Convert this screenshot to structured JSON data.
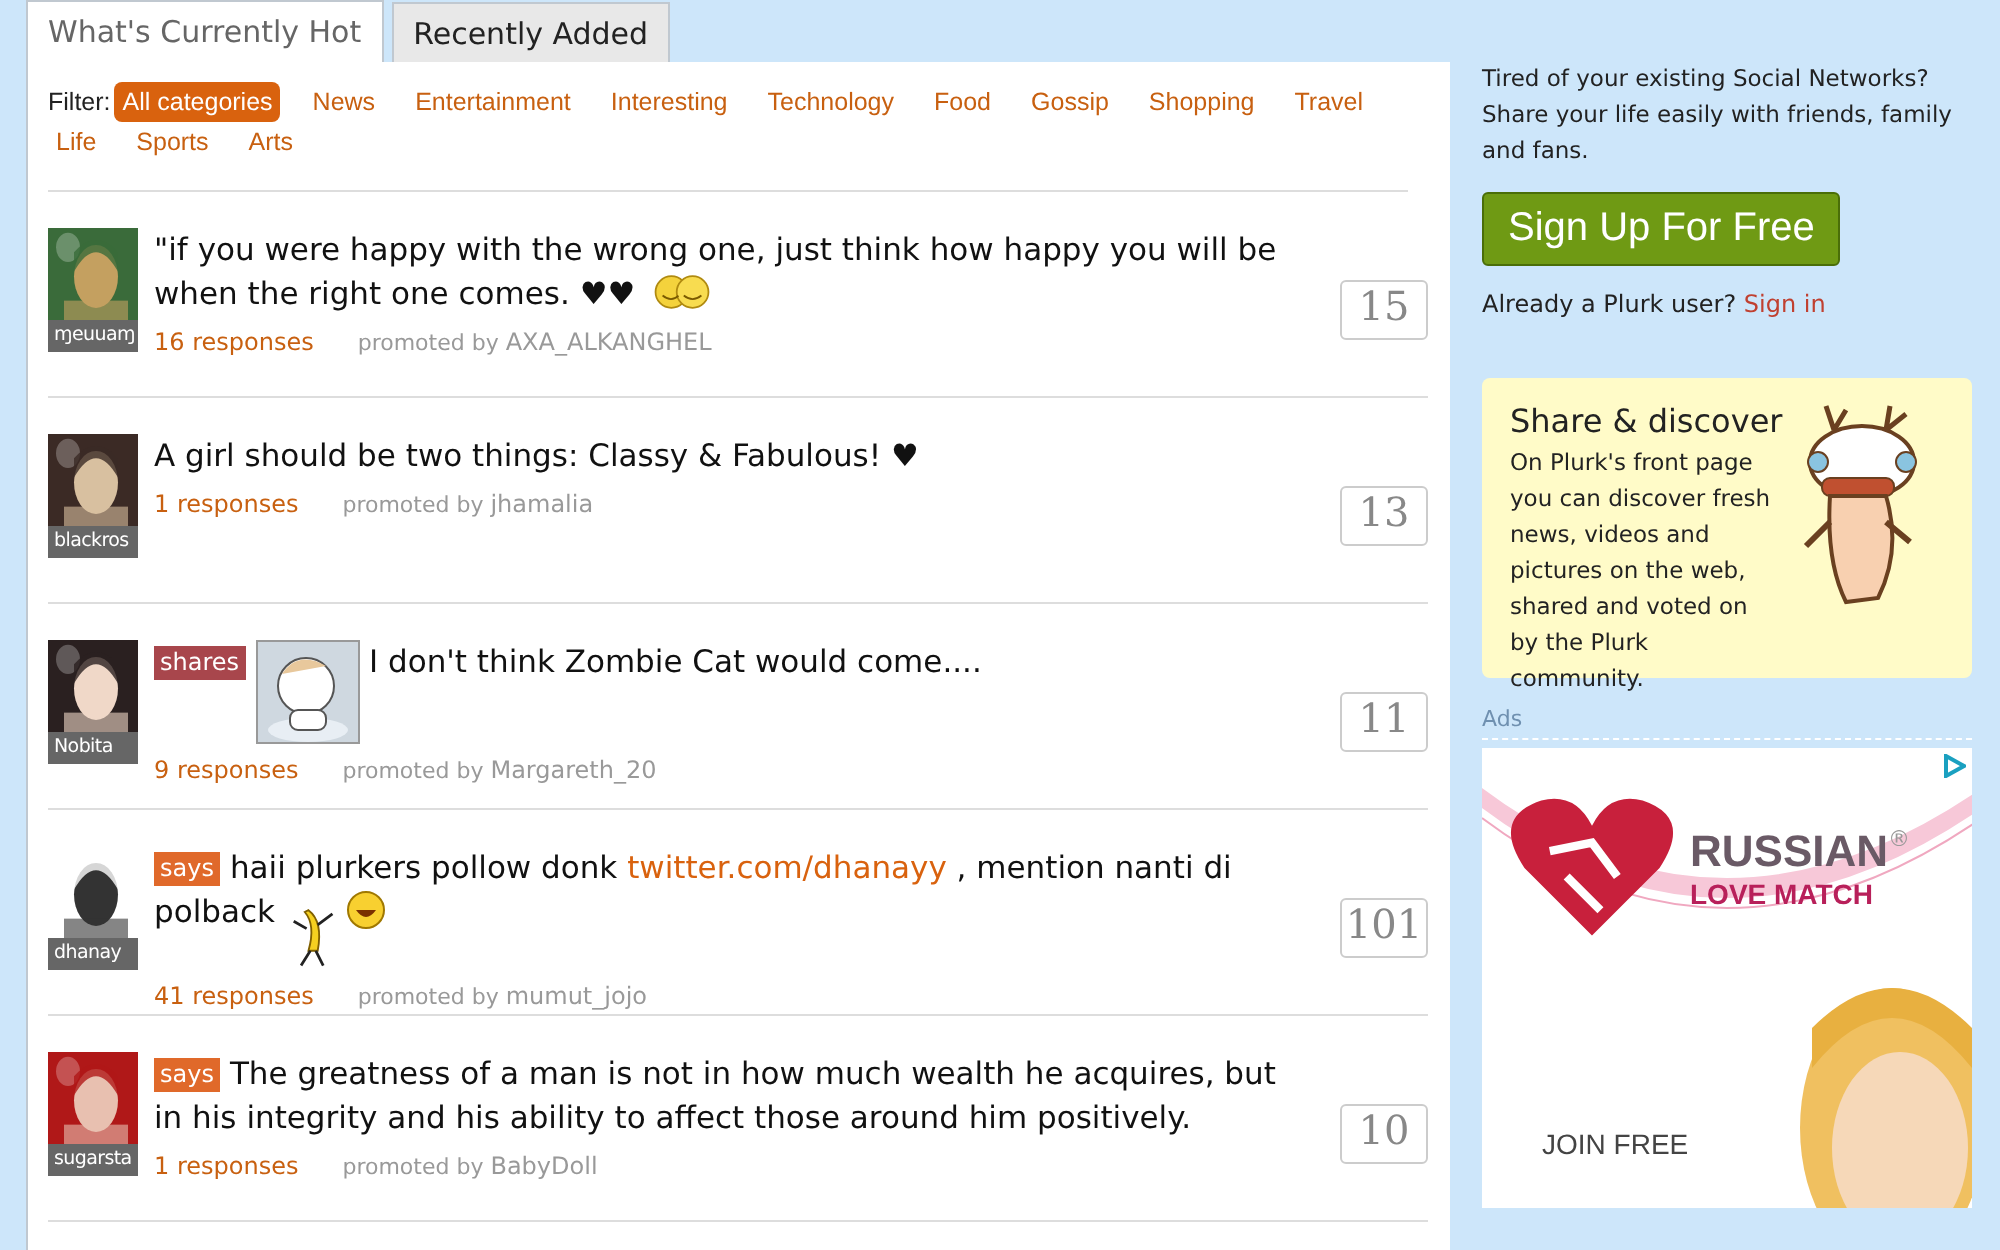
{
  "tabs": [
    {
      "label": "What's Currently Hot",
      "selected": true
    },
    {
      "label": "Recently Added",
      "selected": false
    }
  ],
  "filter": {
    "label": "Filter:",
    "categories": [
      {
        "label": "All categories",
        "selected": true
      },
      {
        "label": "News",
        "selected": false
      },
      {
        "label": "Entertainment",
        "selected": false
      },
      {
        "label": "Interesting",
        "selected": false
      },
      {
        "label": "Technology",
        "selected": false
      },
      {
        "label": "Food",
        "selected": false
      },
      {
        "label": "Gossip",
        "selected": false
      },
      {
        "label": "Shopping",
        "selected": false
      },
      {
        "label": "Travel",
        "selected": false
      },
      {
        "label": "Life",
        "selected": false
      },
      {
        "label": "Sports",
        "selected": false
      },
      {
        "label": "Arts",
        "selected": false
      }
    ]
  },
  "posts": [
    {
      "user": "ɱeuuaɱ",
      "lines": [
        [
          {
            "kind": "text",
            "text": "\"if you were happy with the wrong one, just think how happy you will be"
          }
        ],
        [
          {
            "kind": "text",
            "text": "when the right one comes. ♥♥"
          }
        ]
      ],
      "emoticons": [
        {
          "kind": "hug"
        }
      ],
      "responses": "16 responses",
      "promoted_label": "promoted by",
      "promoter": "AXA_ALKANGHEL",
      "count": "15"
    },
    {
      "user": "blackros",
      "lines": [
        [
          {
            "kind": "text",
            "text": "A girl should be two things: Classy & Fabulous! ♥"
          }
        ]
      ],
      "responses": "1 responses",
      "promoted_label": "promoted by",
      "promoter": "jhamalia",
      "count": "13"
    },
    {
      "user": "Nobita",
      "qualifier": {
        "text": "shares",
        "color": "#a8464c"
      },
      "thumbnail": {
        "kind": "picture"
      },
      "lines": [
        [
          {
            "kind": "text",
            "text": "I don't think Zombie Cat would come...."
          }
        ]
      ],
      "responses": "9 responses",
      "promoted_label": "promoted by",
      "promoter": "Margareth_20",
      "count": "11"
    },
    {
      "user": "dhanay",
      "qualifier": {
        "text": "says",
        "color": "#e0692a"
      },
      "lines": [
        [
          {
            "kind": "text",
            "text": "haii plurkers pollow donk "
          },
          {
            "kind": "link",
            "text": "twitter.com/dhanayy"
          },
          {
            "kind": "text",
            "text": " , mention nanti di"
          }
        ],
        [
          {
            "kind": "text",
            "text": "polback"
          }
        ]
      ],
      "emoticons": [
        {
          "kind": "banana"
        },
        {
          "kind": "grin"
        }
      ],
      "responses": "41 responses",
      "promoted_label": "promoted by",
      "promoter": "mumut_jojo",
      "count": "101"
    },
    {
      "user": "sugarsta",
      "qualifier": {
        "text": "says",
        "color": "#e0692a"
      },
      "lines": [
        [
          {
            "kind": "text",
            "text": "The greatness of a man is not in how much wealth he acquires, but"
          }
        ],
        [
          {
            "kind": "text",
            "text": "in his integrity and his ability to affect those around him positively."
          }
        ]
      ],
      "responses": "1 responses",
      "promoted_label": "promoted by",
      "promoter": "BabyDoll",
      "count": "10"
    }
  ],
  "sidebar": {
    "intro": "Tired of your existing Social Networks? Share your life easily with friends, family and fans.",
    "signup_button": "Sign Up For Free",
    "signin_prompt": "Already a Plurk user?",
    "signin_link": "Sign in",
    "promo": {
      "title": "Share & discover",
      "text": "On Plurk's front page you can discover fresh news, videos and pictures on the web, shared and voted on by the Plurk community."
    },
    "ads": {
      "label": "Ads",
      "brand": "RUSSIAN",
      "brand_mark": "®",
      "tagline": "LOVE MATCH",
      "cta": "JOIN FREE"
    }
  }
}
